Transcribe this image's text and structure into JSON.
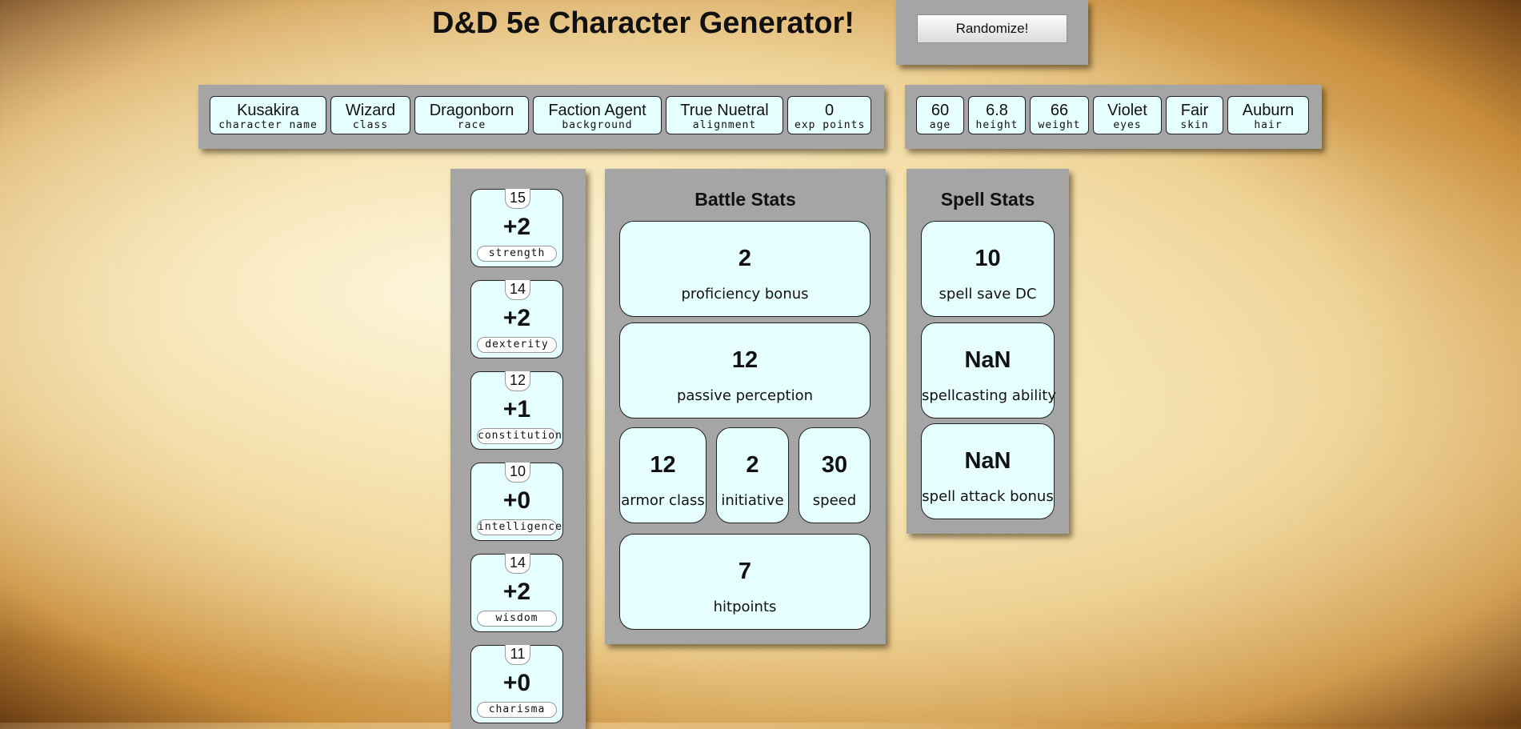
{
  "page": {
    "title": "D&D 5e Character Generator!"
  },
  "toolbar": {
    "randomize_label": "Randomize!"
  },
  "character_info": [
    {
      "value": "Kusakira",
      "label": "character name"
    },
    {
      "value": "Wizard",
      "label": "class"
    },
    {
      "value": "Dragonborn",
      "label": "race"
    },
    {
      "value": "Faction Agent",
      "label": "background"
    },
    {
      "value": "True Nuetral",
      "label": "alignment"
    },
    {
      "value": "0",
      "label": "exp points"
    }
  ],
  "appearance": [
    {
      "value": "60",
      "label": "age"
    },
    {
      "value": "6.8",
      "label": "height"
    },
    {
      "value": "66",
      "label": "weight"
    },
    {
      "value": "Violet",
      "label": "eyes"
    },
    {
      "value": "Fair",
      "label": "skin"
    },
    {
      "value": "Auburn",
      "label": "hair"
    }
  ],
  "abilities": [
    {
      "score": "15",
      "modifier": "+2",
      "name": "strength"
    },
    {
      "score": "14",
      "modifier": "+2",
      "name": "dexterity"
    },
    {
      "score": "12",
      "modifier": "+1",
      "name": "constitution"
    },
    {
      "score": "10",
      "modifier": "+0",
      "name": "intelligence"
    },
    {
      "score": "14",
      "modifier": "+2",
      "name": "wisdom"
    },
    {
      "score": "11",
      "modifier": "+0",
      "name": "charisma"
    }
  ],
  "battle_stats": {
    "title": "Battle Stats",
    "proficiency_bonus": {
      "value": "2",
      "label": "proficiency bonus"
    },
    "passive_perception": {
      "value": "12",
      "label": "passive perception"
    },
    "armor_class": {
      "value": "12",
      "label": "armor class"
    },
    "initiative": {
      "value": "2",
      "label": "initiative"
    },
    "speed": {
      "value": "30",
      "label": "speed"
    },
    "hitpoints": {
      "value": "7",
      "label": "hitpoints"
    }
  },
  "spell_stats": {
    "title": "Spell Stats",
    "spell_save_dc": {
      "value": "10",
      "label": "spell save DC"
    },
    "spellcasting_ability": {
      "value": "NaN",
      "label": "spellcasting ability"
    },
    "spell_attack_bonus": {
      "value": "NaN",
      "label": "spell attack bonus"
    }
  }
}
